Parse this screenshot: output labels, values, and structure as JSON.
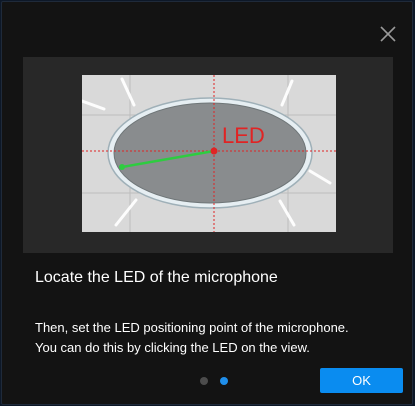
{
  "dialog": {
    "title": "Locate the LED of the microphone",
    "description_line1": "Then, set the LED positioning point of the microphone.",
    "description_line2": "You can do this by clicking the LED on the view.",
    "ok_label": "OK",
    "close_icon": "close-icon",
    "preview": {
      "led_label": "LED",
      "led_color": "#e02424",
      "pointer_color": "#2ecc40",
      "guide_color": "#e02424"
    },
    "pagination": {
      "total_pages": 2,
      "current_page": 2
    }
  },
  "colors": {
    "accent": "#0a8cf0",
    "background": "#131313",
    "preview_background": "#282828"
  }
}
